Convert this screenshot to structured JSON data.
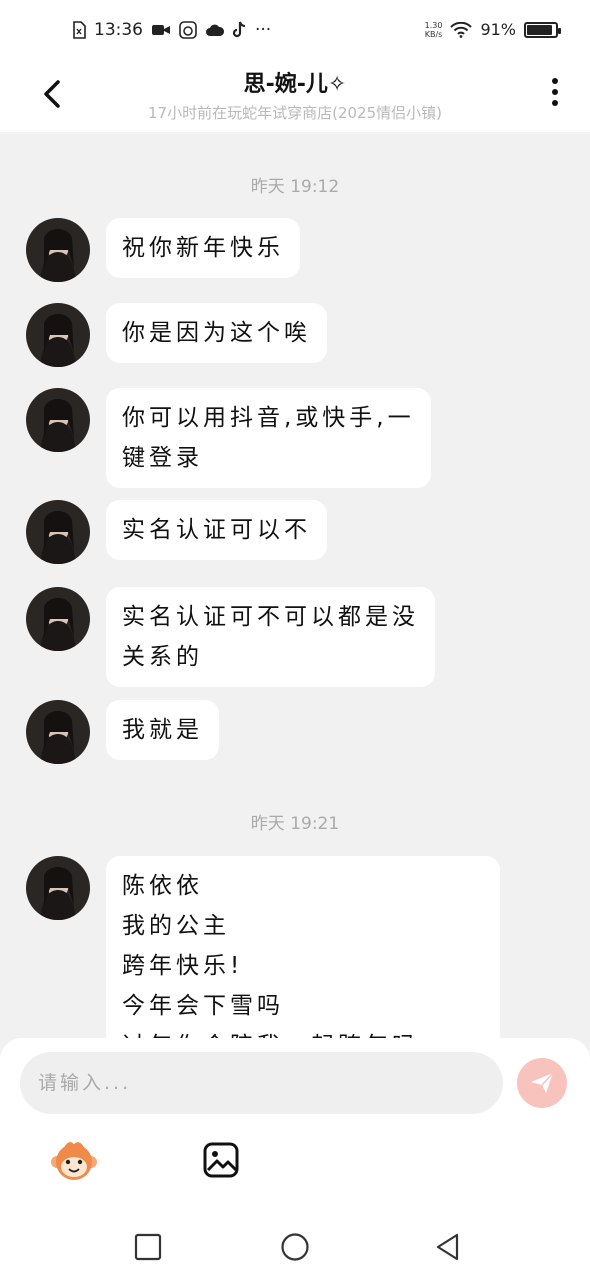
{
  "status_bar": {
    "time": "13:36",
    "net_speed_value": "1.30",
    "net_speed_unit": "KB/s",
    "battery": "91%",
    "battery_level": 0.91,
    "notification_icons": [
      "sim-card-icon",
      "video-camera-icon",
      "game-app-icon",
      "cloud-icon",
      "tiktok-icon"
    ],
    "more_notifications": "···"
  },
  "header": {
    "title": "思-婉-儿✧",
    "subtitle": "17小时前在玩蛇年试穿商店(2025情侣小镇)"
  },
  "timestamps": [
    "昨天 19:12",
    "昨天 19:21"
  ],
  "messages": [
    {
      "text": "祝你新年快乐"
    },
    {
      "text": "你是因为这个唉"
    },
    {
      "text": "你可以用抖音,或快手,一\n键登录"
    },
    {
      "text": "实名认证可以不"
    },
    {
      "text": "实名认证可不可以都是没\n关系的"
    },
    {
      "text": "我就是"
    },
    {
      "text": "陈依依\n我的公主\n跨年快乐!\n今年会下雪吗\n过年你会陪我一起跨年吗"
    }
  ],
  "input": {
    "placeholder": "请输入..."
  },
  "icons": {
    "send": "send-icon",
    "emoji": "monkey-emoji-icon",
    "gallery": "image-gallery-icon"
  },
  "colors": {
    "send_button": "#f9c3bd",
    "background": "#f1f1f1",
    "bubble": "#ffffff"
  }
}
